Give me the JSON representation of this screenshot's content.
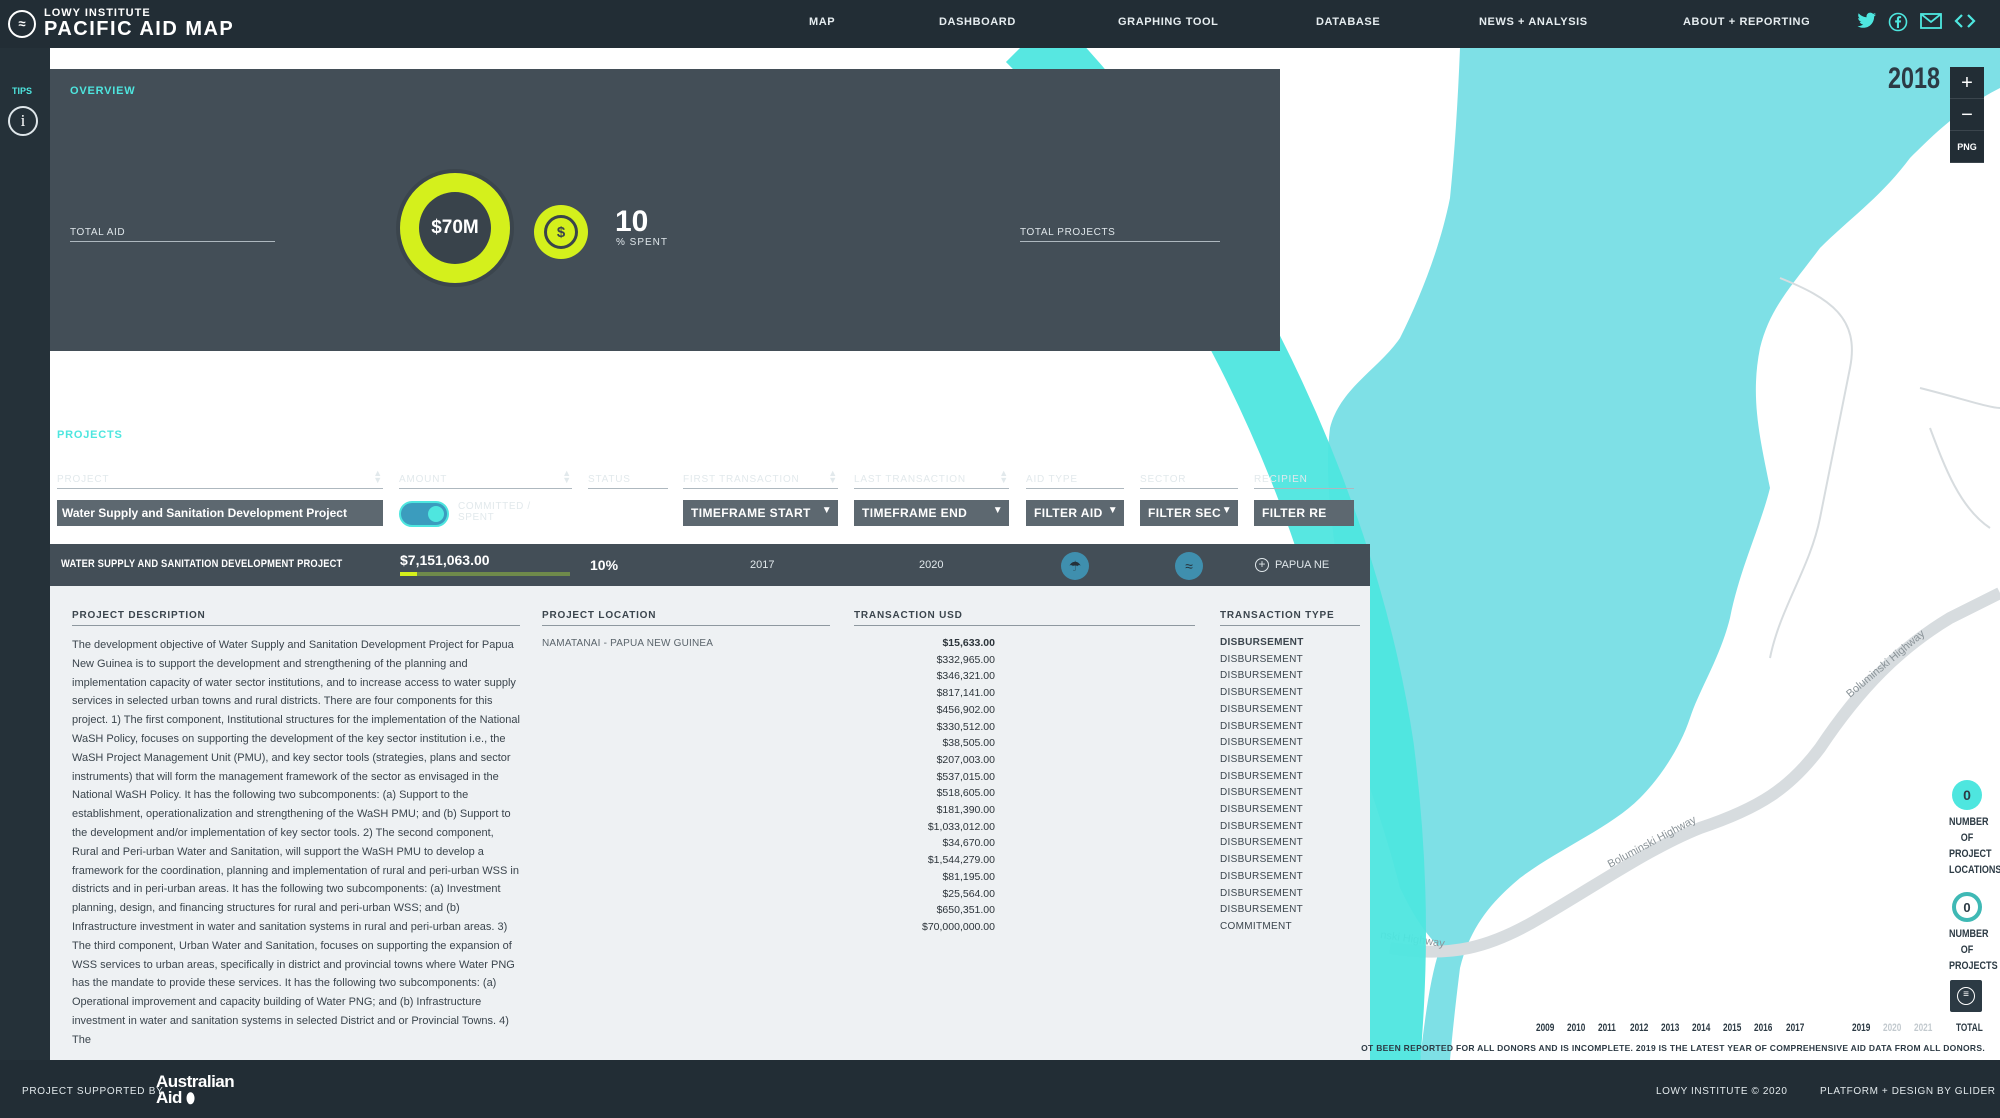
{
  "brand": {
    "line1": "LOWY INSTITUTE",
    "line2": "PACIFIC AID MAP"
  },
  "nav": [
    "MAP",
    "DASHBOARD",
    "GRAPHING TOOL",
    "DATABASE",
    "NEWS + ANALYSIS",
    "ABOUT + REPORTING"
  ],
  "social": {
    "twitter": "twitter-icon",
    "facebook": "facebook-icon",
    "email": "mail-icon",
    "embed": "code-icon"
  },
  "tips": {
    "label": "TIPS",
    "icon": "i"
  },
  "overview": {
    "title": "OVERVIEW",
    "total_aid_label": "TOTAL AID",
    "total_aid_value": "$70M",
    "spent_value": "10",
    "spent_label": "% SPENT",
    "total_projects_label": "TOTAL PROJECTS"
  },
  "projects": {
    "title": "PROJECTS",
    "columns": {
      "project": "PROJECT",
      "amount": "AMOUNT",
      "status": "STATUS",
      "first": "FIRST TRANSACTION",
      "last": "LAST TRANSACTION",
      "aid_type": "AID TYPE",
      "sector": "SECTOR",
      "recipient": "RECIPIEN"
    },
    "search_value": "Water Supply and Sanitation Development Project",
    "toggle_label_1": "COMMITTED /",
    "toggle_label_2": "SPENT",
    "filters": {
      "start": "TIMEFRAME START",
      "end": "TIMEFRAME END",
      "aid": "FILTER AID",
      "sector": "FILTER SEC",
      "recipient": "FILTER RE"
    },
    "row": {
      "name": "WATER SUPPLY AND SANITATION DEVELOPMENT PROJECT",
      "amount": "$7,151,063.00",
      "spent_fraction": 0.1,
      "status": "10%",
      "first": "2017",
      "last": "2020",
      "recipient": "PAPUA NE"
    },
    "detail": {
      "desc_header": "PROJECT DESCRIPTION",
      "loc_header": "PROJECT LOCATION",
      "tx_header": "TRANSACTION USD",
      "type_header": "TRANSACTION TYPE",
      "location": "NAMATANAI - PAPUA NEW GUINEA",
      "description": "The development objective of Water Supply and Sanitation Development Project for Papua New Guinea is to support the development and strengthening of the planning and implementation capacity of water sector institutions, and to increase access to water supply services in selected urban towns and rural districts. There are four components for this project. 1) The first component, Institutional structures for the implementation of the National WaSH Policy, focuses on supporting the development of the key sector institution i.e., the WaSH Project Management Unit (PMU), and key sector tools (strategies, plans and sector instruments) that will form the management framework of the sector as envisaged in the National WaSH Policy. It has the following two subcomponents: (a) Support to the establishment, operationalization and strengthening of the WaSH PMU; and (b) Support to the development and/or implementation of key sector tools. 2) The second component, Rural and Peri-urban Water and Sanitation, will support the WaSH PMU to develop a framework for the coordination, planning and implementation of rural and peri-urban WSS in districts and in peri-urban areas. It has the following two subcomponents: (a) Investment planning, design, and financing structures for rural and peri-urban WSS; and (b) Infrastructure investment in water and sanitation systems in rural and peri-urban areas. 3) The third component, Urban Water and Sanitation, focuses on supporting the expansion of WSS services to urban areas, specifically in district and provincial towns where Water PNG has the mandate to provide these services. It has the following two subcomponents: (a) Operational improvement and capacity building of Water PNG; and (b) Infrastructure investment in water and sanitation systems in selected District and or Provincial Towns. 4) The",
      "transactions": [
        {
          "amount": "$15,633.00",
          "type": "DISBURSEMENT"
        },
        {
          "amount": "$332,965.00",
          "type": "DISBURSEMENT"
        },
        {
          "amount": "$346,321.00",
          "type": "DISBURSEMENT"
        },
        {
          "amount": "$817,141.00",
          "type": "DISBURSEMENT"
        },
        {
          "amount": "$456,902.00",
          "type": "DISBURSEMENT"
        },
        {
          "amount": "$330,512.00",
          "type": "DISBURSEMENT"
        },
        {
          "amount": "$38,505.00",
          "type": "DISBURSEMENT"
        },
        {
          "amount": "$207,003.00",
          "type": "DISBURSEMENT"
        },
        {
          "amount": "$537,015.00",
          "type": "DISBURSEMENT"
        },
        {
          "amount": "$518,605.00",
          "type": "DISBURSEMENT"
        },
        {
          "amount": "$181,390.00",
          "type": "DISBURSEMENT"
        },
        {
          "amount": "$1,033,012.00",
          "type": "DISBURSEMENT"
        },
        {
          "amount": "$34,670.00",
          "type": "DISBURSEMENT"
        },
        {
          "amount": "$1,544,279.00",
          "type": "DISBURSEMENT"
        },
        {
          "amount": "$81,195.00",
          "type": "DISBURSEMENT"
        },
        {
          "amount": "$25,564.00",
          "type": "DISBURSEMENT"
        },
        {
          "amount": "$650,351.00",
          "type": "DISBURSEMENT"
        },
        {
          "amount": "$70,000,000.00",
          "type": "COMMITMENT"
        }
      ]
    }
  },
  "map": {
    "year": "2018",
    "zoom_in": "+",
    "zoom_out": "−",
    "png": "PNG",
    "road_labels": [
      "Boluminski Highway",
      "Boluminski Highway",
      "nski Highway"
    ],
    "stats": [
      {
        "value": "0",
        "label": [
          "NUMBER",
          "OF",
          "PROJECT",
          "LOCATIONS"
        ]
      },
      {
        "value": "0",
        "label": [
          "NUMBER",
          "OF",
          "PROJECTS"
        ]
      }
    ],
    "timeline": [
      "2009",
      "2010",
      "2011",
      "2012",
      "2013",
      "2014",
      "2015",
      "2016",
      "2017",
      "2019",
      "2020",
      "2021",
      "TOTAL"
    ],
    "timeline_dim": [
      "2020",
      "2021"
    ],
    "notice": "OT BEEN REPORTED FOR ALL DONORS AND IS INCOMPLETE. 2019 IS THE LATEST YEAR OF COMPREHENSIVE AID DATA FROM ALL DONORS."
  },
  "footer": {
    "supported": "PROJECT SUPPORTED BY",
    "aid_logo_1": "Australian",
    "aid_logo_2": "Aid",
    "copyright": "LOWY INSTITUTE © 2020",
    "platform": "PLATFORM + DESIGN BY GLIDER"
  },
  "colors": {
    "accent": "#4ee6df",
    "lime": "#d4f01c",
    "dark": "#222d35",
    "panel": "#434e57",
    "sea": "#7ed9e6"
  }
}
